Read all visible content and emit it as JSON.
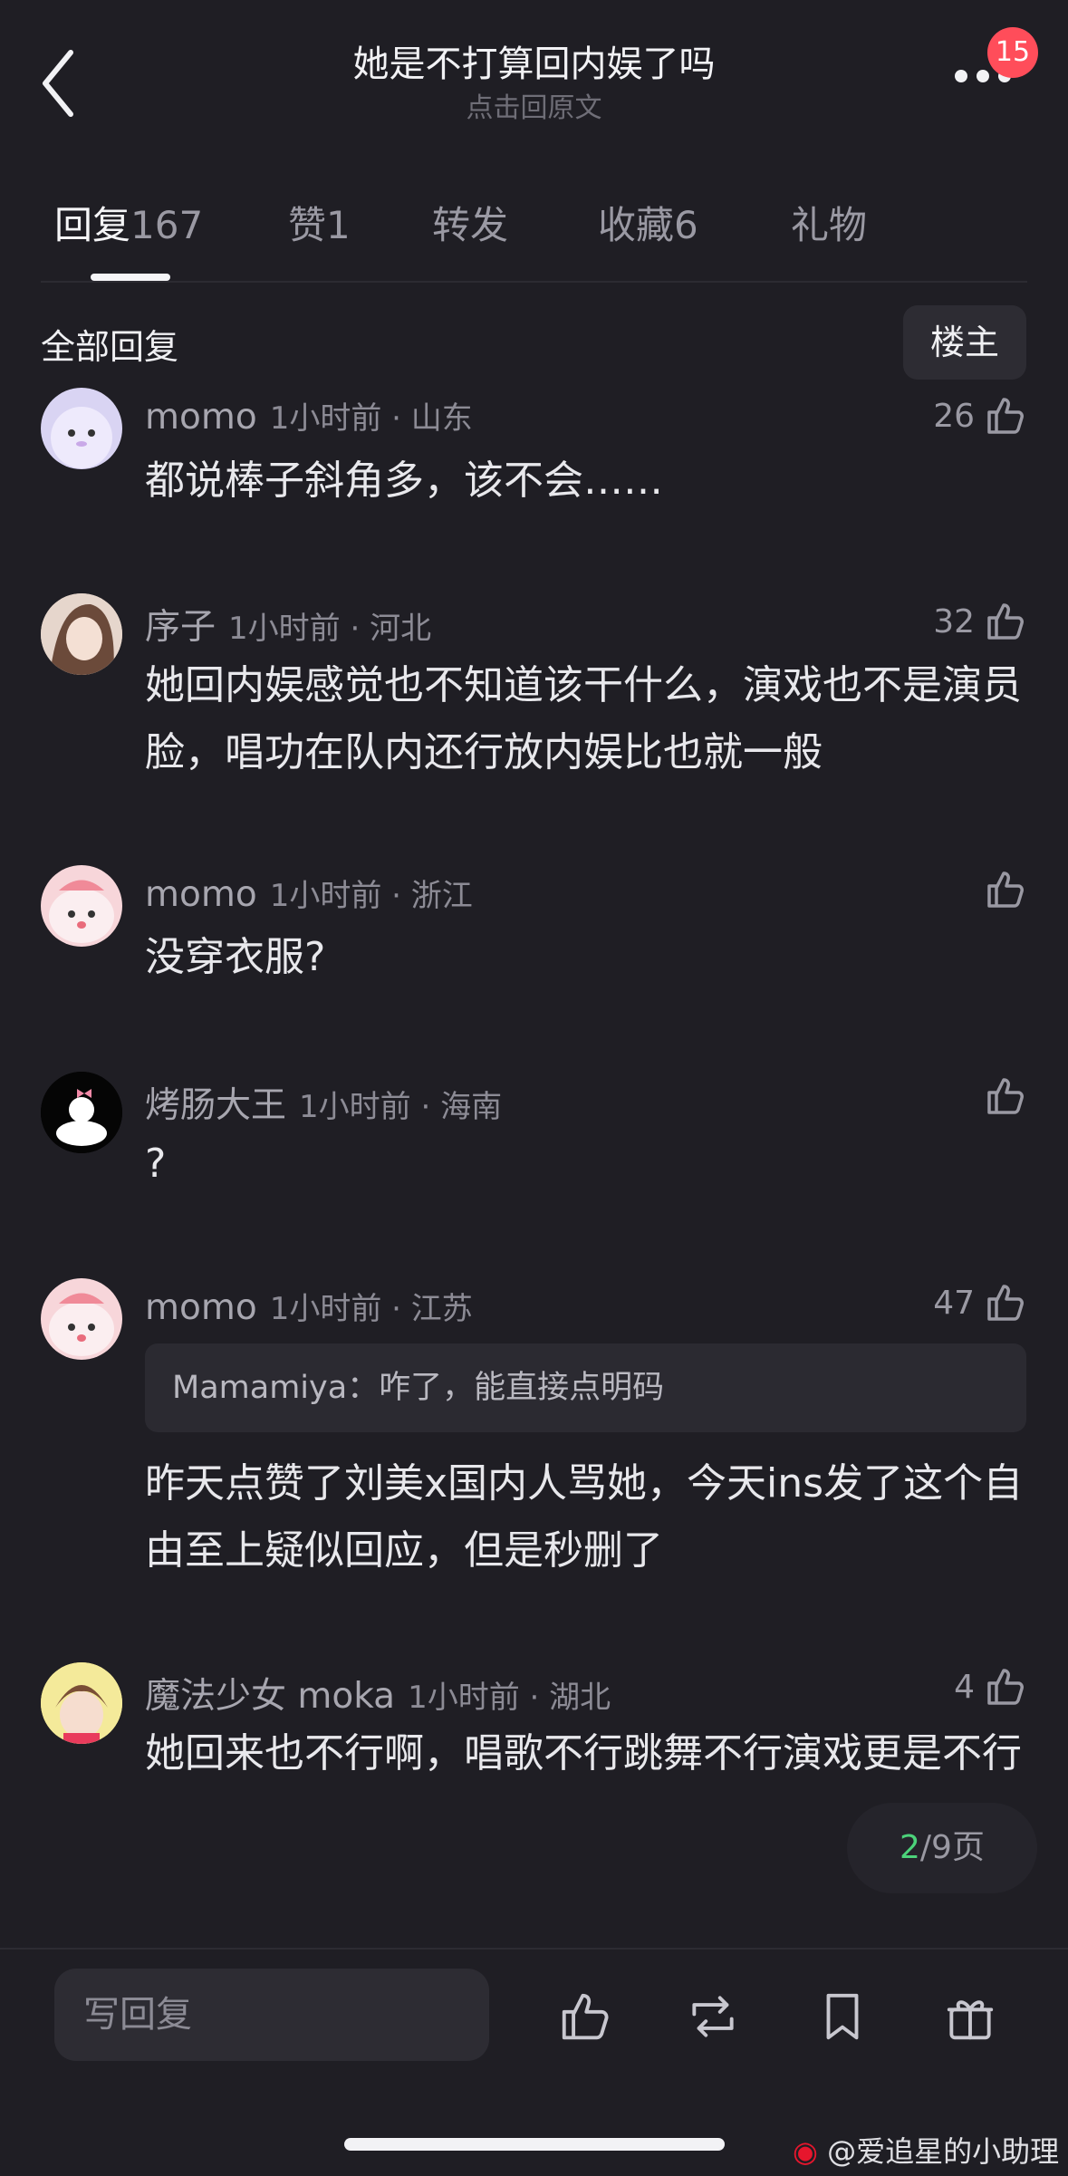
{
  "header": {
    "title": "她是不打算回内娱了吗",
    "subtitle": "点击回原文",
    "notification_badge": "15"
  },
  "tabs": [
    {
      "label": "回复",
      "count": "167"
    },
    {
      "label": "赞",
      "count": "1"
    },
    {
      "label": "转发",
      "count": ""
    },
    {
      "label": "收藏",
      "count": "6"
    },
    {
      "label": "礼物",
      "count": ""
    }
  ],
  "section": {
    "title": "全部回复",
    "op_button": "楼主"
  },
  "comments": [
    {
      "username": "momo",
      "meta": "1小时前 · 山东",
      "likes": "26",
      "text": "都说棒子斜角多，该不会……"
    },
    {
      "username": "序子",
      "meta": "1小时前 · 河北",
      "likes": "32",
      "text": "她回内娱感觉也不知道该干什么，演戏也不是演员脸，唱功在队内还行放内娱比也就一般"
    },
    {
      "username": "momo",
      "meta": "1小时前 · 浙江",
      "likes": "",
      "text": "没穿衣服?"
    },
    {
      "username": "烤肠大王",
      "meta": "1小时前 · 海南",
      "likes": "",
      "text": "?"
    },
    {
      "username": "momo",
      "meta": "1小时前 · 江苏",
      "likes": "47",
      "quote": "Mamamiya：咋了，能直接点明码",
      "text": "昨天点赞了刘美x国内人骂她，今天ins发了这个自由至上疑似回应，但是秒删了"
    },
    {
      "username": "魔法少女 moka",
      "meta": "1小时前 · 湖北",
      "likes": "4",
      "text": "她回来也不行啊，唱歌不行跳舞不行演戏更是不行"
    }
  ],
  "pager": {
    "current": "2",
    "total": "/9页"
  },
  "bottom_bar": {
    "reply_placeholder": "写回复"
  },
  "watermark": "@爱追星的小助理",
  "colors": {
    "background": "#1f1e24",
    "badge": "#ff4d5a",
    "pager_current": "#4cd37a"
  }
}
